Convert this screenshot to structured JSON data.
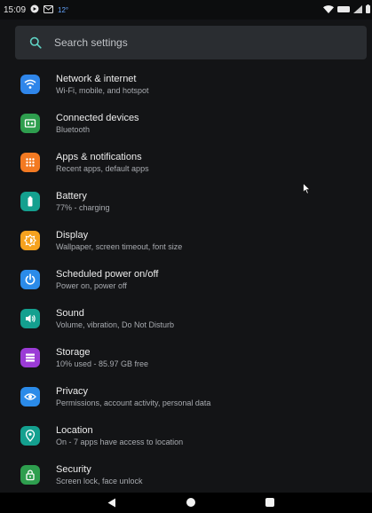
{
  "status_bar": {
    "time": "15:09",
    "temperature": "12°"
  },
  "search": {
    "placeholder": "Search settings"
  },
  "items": [
    {
      "title": "Network & internet",
      "subtitle": "Wi-Fi, mobile, and hotspot",
      "icon": "wifi-icon",
      "color": "#2f86ea"
    },
    {
      "title": "Connected devices",
      "subtitle": "Bluetooth",
      "icon": "connected-devices-icon",
      "color": "#2e9e4e"
    },
    {
      "title": "Apps & notifications",
      "subtitle": "Recent apps, default apps",
      "icon": "apps-grid-icon",
      "color": "#f37a22"
    },
    {
      "title": "Battery",
      "subtitle": "77% - charging",
      "icon": "battery-icon",
      "color": "#14a08f"
    },
    {
      "title": "Display",
      "subtitle": "Wallpaper, screen timeout, font size",
      "icon": "display-brightness-icon",
      "color": "#f6a21e"
    },
    {
      "title": "Scheduled power on/off",
      "subtitle": "Power on, power off",
      "icon": "power-icon",
      "color": "#2b8be9"
    },
    {
      "title": "Sound",
      "subtitle": "Volume, vibration, Do Not Disturb",
      "icon": "sound-icon",
      "color": "#14a08f"
    },
    {
      "title": "Storage",
      "subtitle": "10% used - 85.97 GB free",
      "icon": "storage-icon",
      "color": "#9b3bd6"
    },
    {
      "title": "Privacy",
      "subtitle": "Permissions, account activity, personal data",
      "icon": "privacy-eye-icon",
      "color": "#2b8be9"
    },
    {
      "title": "Location",
      "subtitle": "On - 7 apps have access to location",
      "icon": "location-pin-icon",
      "color": "#14a08f"
    },
    {
      "title": "Security",
      "subtitle": "Screen lock, face unlock",
      "icon": "lock-icon",
      "color": "#2e9e4e"
    }
  ]
}
